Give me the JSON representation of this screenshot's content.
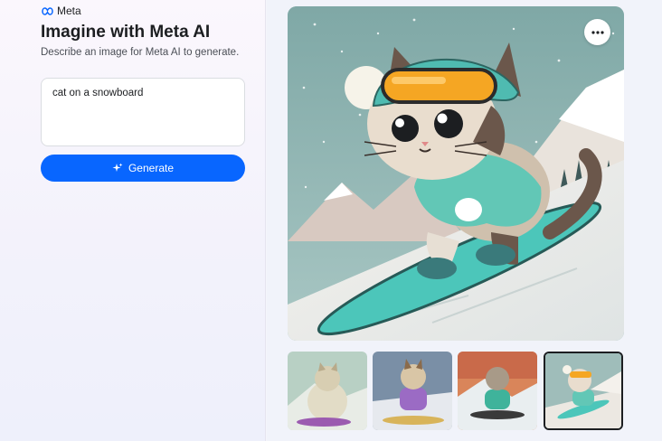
{
  "brand": {
    "name": "Meta",
    "logo_icon": "meta-infinity-icon"
  },
  "header": {
    "title": "Imagine with Meta AI",
    "subtitle": "Describe an image for Meta AI to generate."
  },
  "prompt": {
    "value": "cat on a snowboard"
  },
  "generate_button": {
    "label": "Generate",
    "icon": "sparkle-icon"
  },
  "main_image": {
    "description_icon": "cat-snowboard-image",
    "more_icon": "more-horizontal-icon"
  },
  "thumbnails": [
    {
      "name": "thumbnail-1",
      "selected": false
    },
    {
      "name": "thumbnail-2",
      "selected": false
    },
    {
      "name": "thumbnail-3",
      "selected": false
    },
    {
      "name": "thumbnail-4",
      "selected": true
    }
  ],
  "colors": {
    "accent": "#0866ff",
    "text_primary": "#1c1e21",
    "snowboard": "#4cc6ba",
    "goggles": "#f5a623"
  }
}
